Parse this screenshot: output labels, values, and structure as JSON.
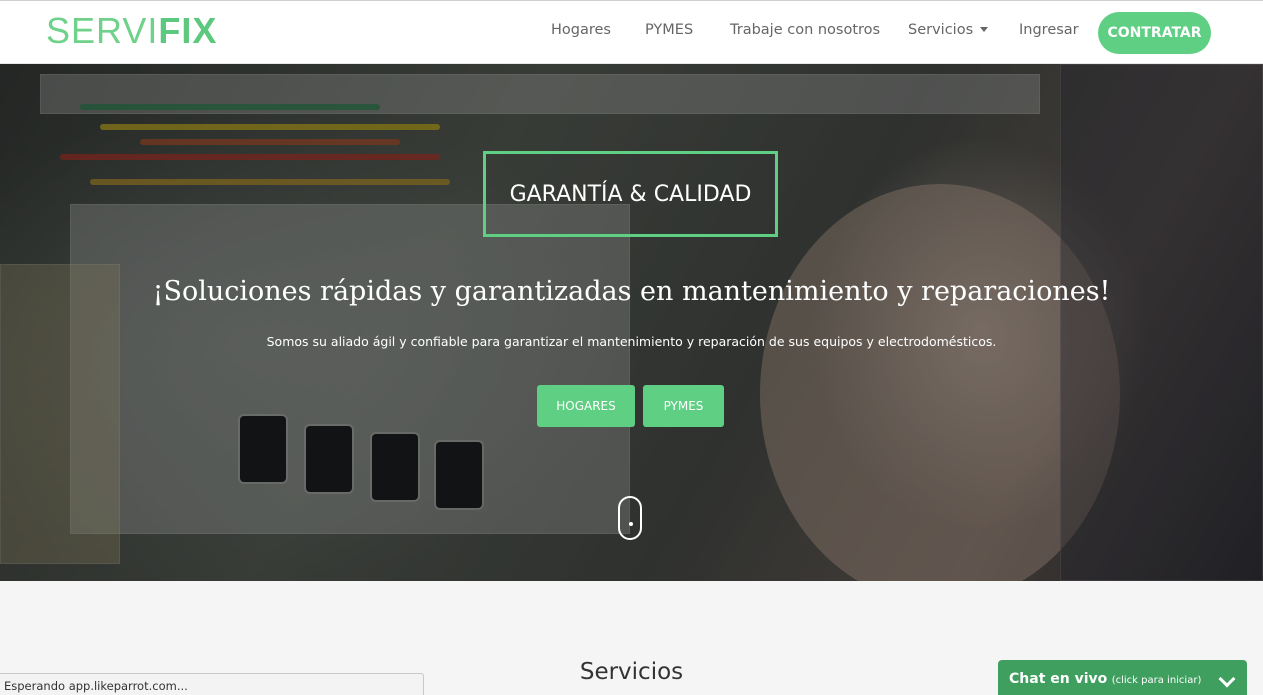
{
  "brand": {
    "part1": "SERVI",
    "part2": "FIX"
  },
  "nav": {
    "items": [
      "Hogares",
      "PYMES",
      "Trabaje con nosotros",
      "Servicios",
      "Ingresar"
    ],
    "cta": "CONTRATAR"
  },
  "hero": {
    "badge": "GARANTÍA & CALIDAD",
    "headline": "¡Soluciones rápidas y garantizadas en mantenimiento y reparaciones!",
    "subheadline": "Somos su aliado ágil y confiable para garantizar el mantenimiento y reparación de sus equipos y electrodomésticos.",
    "buttons": [
      "HOGARES",
      "PYMES"
    ]
  },
  "section": {
    "title": "Servicios"
  },
  "status_bar": {
    "text": "Esperando app.likeparrot.com..."
  },
  "chat": {
    "title": "Chat en vivo",
    "hint": "(click para iniciar)"
  },
  "colors": {
    "accent": "#5fcf83",
    "chat": "#3f9f5f",
    "brand_light": "#6fd18a"
  }
}
